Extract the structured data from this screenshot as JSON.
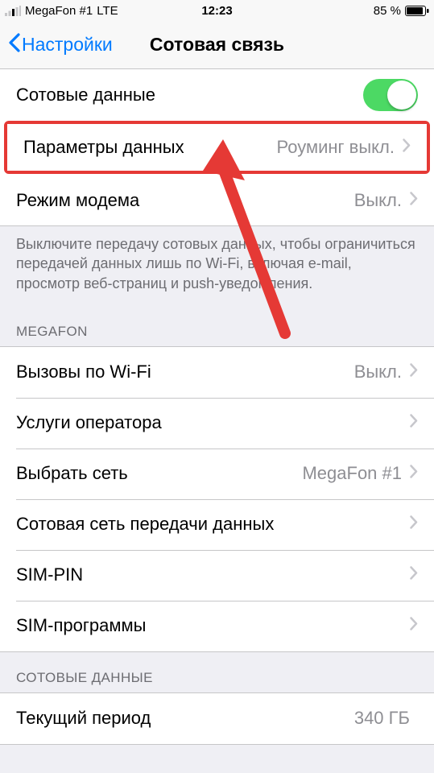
{
  "status_bar": {
    "carrier": "MegaFon #1",
    "network": "LTE",
    "time": "12:23",
    "battery": "85 %"
  },
  "nav": {
    "back_label": "Настройки",
    "title": "Сотовая связь"
  },
  "section1": {
    "cellular_data_label": "Сотовые данные",
    "data_options_label": "Параметры данных",
    "data_options_value": "Роуминг выкл.",
    "hotspot_label": "Режим модема",
    "hotspot_value": "Выкл."
  },
  "footer1": "Выключите передачу сотовых данных, чтобы ограничиться передачей данных лишь по Wi-Fi, включая e-mail, просмотр веб-страниц и push-уведомления.",
  "section2_header": "MEGAFON",
  "section2": {
    "wifi_calls_label": "Вызовы по Wi-Fi",
    "wifi_calls_value": "Выкл.",
    "carrier_services_label": "Услуги оператора",
    "select_network_label": "Выбрать сеть",
    "select_network_value": "MegaFon #1",
    "cellular_apn_label": "Сотовая сеть передачи данных",
    "sim_pin_label": "SIM-PIN",
    "sim_apps_label": "SIM-программы"
  },
  "section3_header": "СОТОВЫЕ ДАННЫЕ",
  "section3": {
    "current_period_label": "Текущий период",
    "current_period_value": "340 ГБ"
  }
}
